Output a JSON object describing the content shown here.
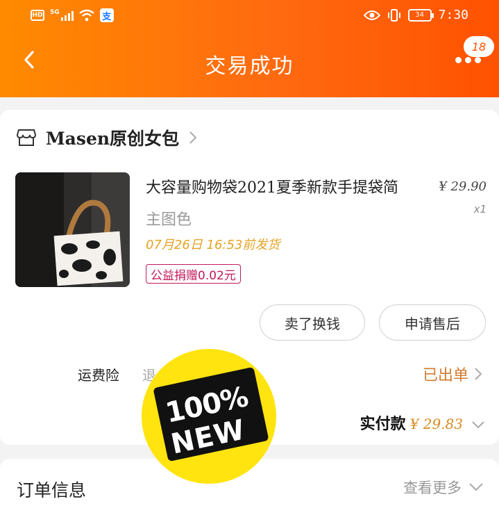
{
  "status_bar": {
    "hd": "HD",
    "network": "5G",
    "alipay_icon": "支",
    "battery": "34",
    "time": "7:30"
  },
  "header": {
    "title": "交易成功",
    "badge_count": "18",
    "colors": {
      "start": "#ff8a00",
      "end": "#ff5200"
    }
  },
  "shop": {
    "name": "Masen原创女包"
  },
  "product": {
    "title": "大容量购物袋2021夏季新款手提袋简",
    "price": "¥ 29.90",
    "quantity": "x1",
    "spec": "主图色",
    "ship_time": "07月26日 16:53前发货",
    "charity": "公益捐赠0.02元"
  },
  "actions": {
    "sell": "卖了换钱",
    "after_sales": "申请售后"
  },
  "insurance": {
    "label": "运费险",
    "desc": "退                        赔",
    "status": "已出单"
  },
  "payment": {
    "label": "实付款",
    "amount": "¥ 29.83"
  },
  "sticker": {
    "line1": "100%",
    "line2": "NEW"
  },
  "order_info": {
    "title": "订单信息",
    "more": "查看更多"
  }
}
